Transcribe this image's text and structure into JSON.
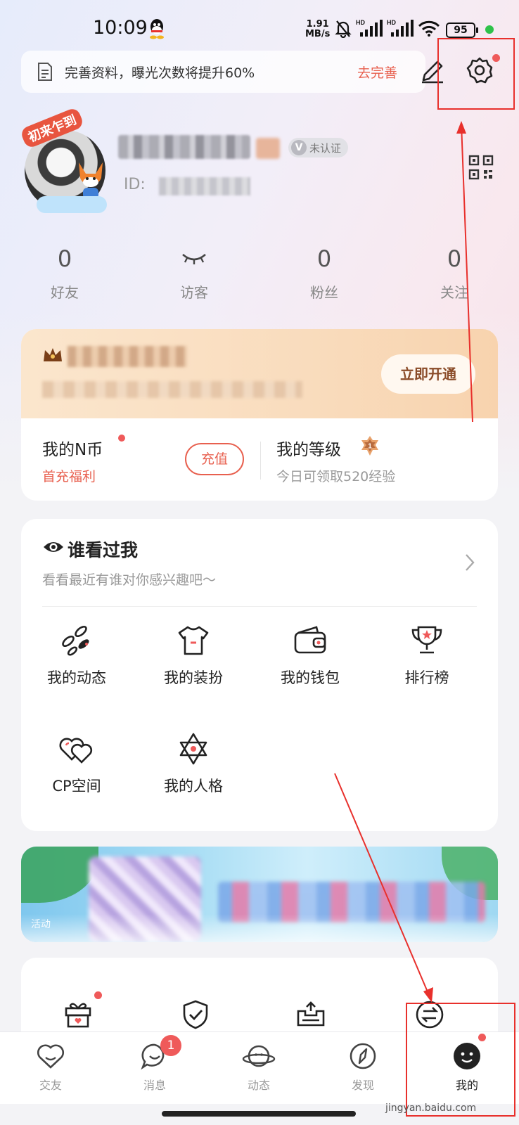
{
  "status_bar": {
    "time": "10:09",
    "net_speed_value": "1.91",
    "net_speed_unit": "MB/s",
    "battery": "95"
  },
  "prompt": {
    "text": "完善资料，曝光次数将提升60%",
    "action": "去完善"
  },
  "profile": {
    "avatar_frame_label": "初来乍到",
    "verify_label": "未认证",
    "id_label": "ID:"
  },
  "stats": [
    {
      "value": "0",
      "label": "好友"
    },
    {
      "value": "",
      "label": "访客"
    },
    {
      "value": "0",
      "label": "粉丝"
    },
    {
      "value": "0",
      "label": "关注"
    }
  ],
  "vip": {
    "open_button": "立即开通"
  },
  "coins": {
    "title": "我的N币",
    "subtitle": "首充福利",
    "recharge_button": "充值"
  },
  "level": {
    "title": "我的等级",
    "badge_value": "1",
    "subtitle": "今日可领取520经验"
  },
  "viewed": {
    "title": "谁看过我",
    "subtitle": "看看最近有谁对你感兴趣吧～"
  },
  "grid": [
    {
      "label": "我的动态",
      "icon": "moments-icon"
    },
    {
      "label": "我的装扮",
      "icon": "outfit-icon"
    },
    {
      "label": "我的钱包",
      "icon": "wallet-icon"
    },
    {
      "label": "排行榜",
      "icon": "trophy-icon"
    },
    {
      "label": "CP空间",
      "icon": "double-heart-icon"
    },
    {
      "label": "我的人格",
      "icon": "star-of-david-icon"
    }
  ],
  "banner": {
    "tag": "活动"
  },
  "tabs": [
    {
      "label": "交友",
      "icon": "heart-icon"
    },
    {
      "label": "消息",
      "icon": "chat-icon",
      "badge": "1"
    },
    {
      "label": "动态",
      "icon": "planet-icon"
    },
    {
      "label": "发现",
      "icon": "compass-icon"
    },
    {
      "label": "我的",
      "icon": "face-icon",
      "active": true
    }
  ],
  "watermark": "jingyan.baidu.com",
  "colors": {
    "accent": "#e8604f",
    "annotation_red": "#e8302c",
    "badge_red": "#ef5a5a"
  }
}
